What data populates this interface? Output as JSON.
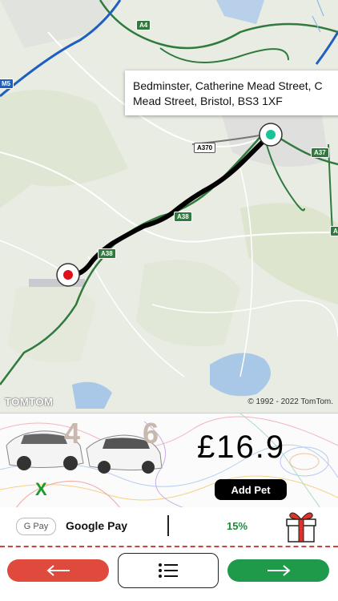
{
  "map": {
    "address_tooltip": [
      "Bedminster, Catherine Mead Street, C",
      "Mead Street, Bristol, BS3 1XF"
    ],
    "attribution": "© 1992 - 2022 TomTom.",
    "logo": "TOMTOM",
    "road_labels": [
      {
        "text": "A4",
        "style": "green"
      },
      {
        "text": "M5",
        "style": "blue"
      },
      {
        "text": "A370",
        "style": "white"
      },
      {
        "text": "A37",
        "style": "green"
      },
      {
        "text": "A38",
        "style": "green"
      },
      {
        "text": "A38",
        "style": "green"
      },
      {
        "text": "A",
        "style": "green"
      }
    ],
    "origin_icon": "green-dot-pin-icon",
    "destination_icon": "red-dot-pin-icon"
  },
  "fare": {
    "price": "£16.9",
    "passenger_count": "4",
    "luggage_count": "6",
    "add_pet_label": "Add Pet",
    "x_label": "X"
  },
  "payment": {
    "badge": "G Pay",
    "method": "Google Pay",
    "discount": "15%",
    "gift_icon": "gift-icon"
  },
  "nav": {
    "back_icon": "arrow-left-icon",
    "list_icon": "list-icon",
    "next_icon": "arrow-right-icon"
  },
  "colors": {
    "route": "#000000",
    "back_button": "#e04a3d",
    "next_button": "#1f9a4a",
    "discount": "#1f8a3a",
    "motorway": "#1f5fbf",
    "a_road": "#2f7a3c"
  }
}
